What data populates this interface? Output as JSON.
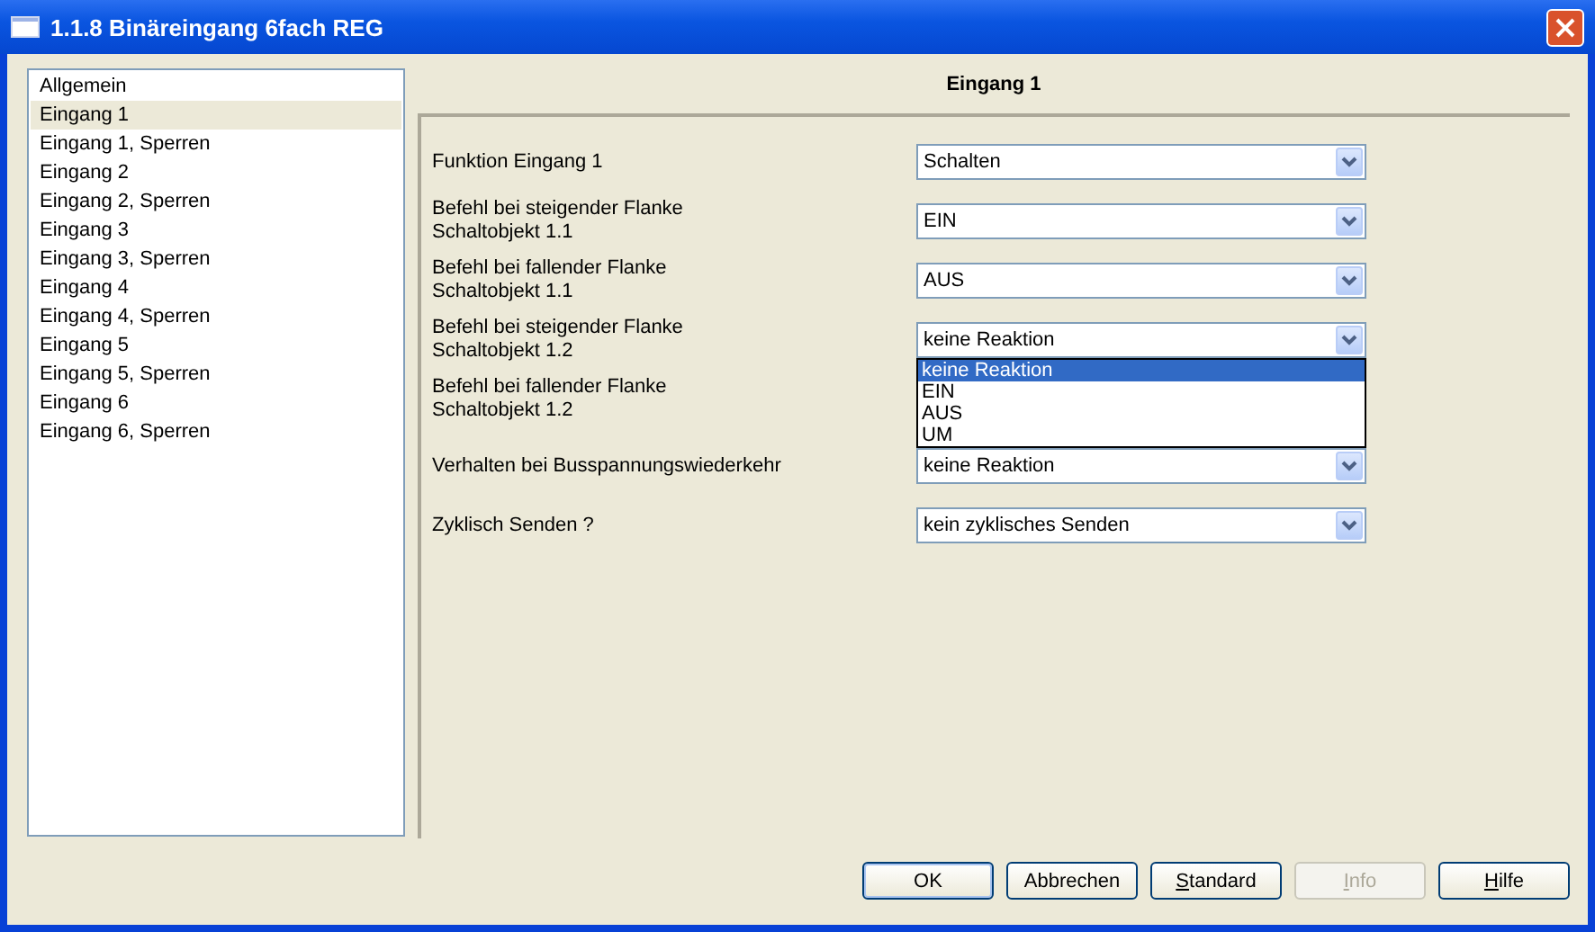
{
  "window": {
    "title": "1.1.8 Binäreingang 6fach REG"
  },
  "sidebar": {
    "items": [
      {
        "label": "Allgemein",
        "selected": false
      },
      {
        "label": "Eingang 1",
        "selected": true
      },
      {
        "label": "Eingang 1, Sperren",
        "selected": false
      },
      {
        "label": "Eingang 2",
        "selected": false
      },
      {
        "label": "Eingang 2, Sperren",
        "selected": false
      },
      {
        "label": "Eingang 3",
        "selected": false
      },
      {
        "label": "Eingang 3, Sperren",
        "selected": false
      },
      {
        "label": "Eingang 4",
        "selected": false
      },
      {
        "label": "Eingang 4, Sperren",
        "selected": false
      },
      {
        "label": "Eingang 5",
        "selected": false
      },
      {
        "label": "Eingang 5, Sperren",
        "selected": false
      },
      {
        "label": "Eingang 6",
        "selected": false
      },
      {
        "label": "Eingang 6, Sperren",
        "selected": false
      }
    ]
  },
  "panel": {
    "title": "Eingang 1",
    "parameters": [
      {
        "label": [
          "Funktion Eingang 1"
        ],
        "value": "Schalten"
      },
      {
        "label": [
          "Befehl bei steigender Flanke",
          "Schaltobjekt 1.1"
        ],
        "value": "EIN"
      },
      {
        "label": [
          "Befehl bei fallender Flanke",
          "Schaltobjekt 1.1"
        ],
        "value": "AUS"
      },
      {
        "label": [
          "Befehl bei steigender Flanke",
          "Schaltobjekt 1.2"
        ],
        "value": "keine Reaktion",
        "options": [
          {
            "label": "keine Reaktion",
            "selected": true
          },
          {
            "label": "EIN",
            "selected": false
          },
          {
            "label": "AUS",
            "selected": false
          },
          {
            "label": "UM",
            "selected": false
          }
        ]
      },
      {
        "label": [
          "Befehl bei fallender Flanke",
          "Schaltobjekt 1.2"
        ]
      },
      {
        "label": [
          "Verhalten bei Busspannungswiederkehr"
        ],
        "value": "keine Reaktion"
      },
      {
        "label": [
          "Zyklisch Senden ?"
        ],
        "value": "kein zyklisches Senden"
      }
    ]
  },
  "buttons": [
    {
      "label": "OK",
      "default": true,
      "disabled": false,
      "mnemonic": false
    },
    {
      "label": "Abbrechen",
      "default": false,
      "disabled": false,
      "mnemonic": false
    },
    {
      "label": "Standard",
      "default": false,
      "disabled": false,
      "mnemonic": true
    },
    {
      "label": "Info",
      "default": false,
      "disabled": true,
      "mnemonic": true
    },
    {
      "label": "Hilfe",
      "default": false,
      "disabled": false,
      "mnemonic": true
    }
  ]
}
